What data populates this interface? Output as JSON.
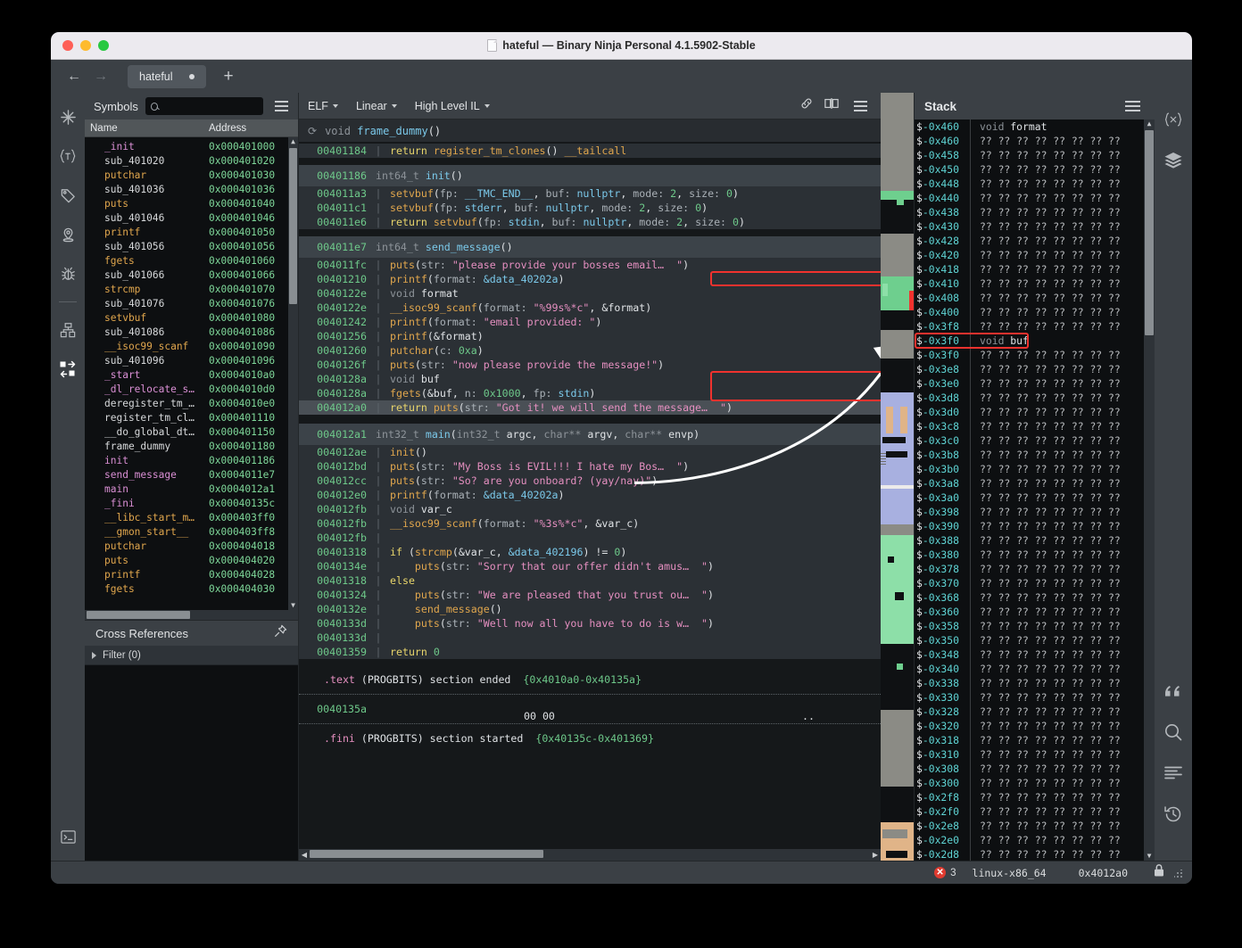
{
  "window": {
    "title": "hateful — Binary Ninja Personal 4.1.5902-Stable",
    "doc_icon": "document-icon"
  },
  "tabbar": {
    "back_icon": "←",
    "forward_icon": "→",
    "tab_label": "hateful",
    "new_tab_icon": "+"
  },
  "left_rail": {
    "icons": [
      "symbols-icon",
      "types-icon",
      "tags-icon",
      "locations-icon",
      "bug-icon",
      "memory-map-icon",
      "stack-transfer-icon",
      "terminal-icon"
    ]
  },
  "symbols_panel": {
    "title": "Symbols",
    "search_placeholder": "",
    "search_value": "",
    "menu_icon": "hamburger-icon",
    "columns": [
      "Name",
      "Address"
    ],
    "rows": [
      {
        "name": "_init",
        "addr": "0x000401000",
        "kind": "imp"
      },
      {
        "name": "sub_401020",
        "addr": "0x000401020",
        "kind": "data"
      },
      {
        "name": "putchar",
        "addr": "0x000401030",
        "kind": "func"
      },
      {
        "name": "sub_401036",
        "addr": "0x000401036",
        "kind": "data"
      },
      {
        "name": "puts",
        "addr": "0x000401040",
        "kind": "func"
      },
      {
        "name": "sub_401046",
        "addr": "0x000401046",
        "kind": "data"
      },
      {
        "name": "printf",
        "addr": "0x000401050",
        "kind": "func"
      },
      {
        "name": "sub_401056",
        "addr": "0x000401056",
        "kind": "data"
      },
      {
        "name": "fgets",
        "addr": "0x000401060",
        "kind": "func"
      },
      {
        "name": "sub_401066",
        "addr": "0x000401066",
        "kind": "data"
      },
      {
        "name": "strcmp",
        "addr": "0x000401070",
        "kind": "func"
      },
      {
        "name": "sub_401076",
        "addr": "0x000401076",
        "kind": "data"
      },
      {
        "name": "setvbuf",
        "addr": "0x000401080",
        "kind": "func"
      },
      {
        "name": "sub_401086",
        "addr": "0x000401086",
        "kind": "data"
      },
      {
        "name": "__isoc99_scanf",
        "addr": "0x000401090",
        "kind": "func"
      },
      {
        "name": "sub_401096",
        "addr": "0x000401096",
        "kind": "data"
      },
      {
        "name": "_start",
        "addr": "0x0004010a0",
        "kind": "imp"
      },
      {
        "name": "_dl_relocate_s…",
        "addr": "0x0004010d0",
        "kind": "imp"
      },
      {
        "name": "deregister_tm_…",
        "addr": "0x0004010e0",
        "kind": "data"
      },
      {
        "name": "register_tm_cl…",
        "addr": "0x000401110",
        "kind": "data"
      },
      {
        "name": "__do_global_dt…",
        "addr": "0x000401150",
        "kind": "data"
      },
      {
        "name": "frame_dummy",
        "addr": "0x000401180",
        "kind": "data"
      },
      {
        "name": "init",
        "addr": "0x000401186",
        "kind": "imp"
      },
      {
        "name": "send_message",
        "addr": "0x0004011e7",
        "kind": "imp"
      },
      {
        "name": "main",
        "addr": "0x0004012a1",
        "kind": "imp"
      },
      {
        "name": "_fini",
        "addr": "0x00040135c",
        "kind": "imp"
      },
      {
        "name": "__libc_start_m…",
        "addr": "0x000403ff0",
        "kind": "func"
      },
      {
        "name": "__gmon_start__",
        "addr": "0x000403ff8",
        "kind": "func"
      },
      {
        "name": "putchar",
        "addr": "0x000404018",
        "kind": "func"
      },
      {
        "name": "puts",
        "addr": "0x000404020",
        "kind": "func"
      },
      {
        "name": "printf",
        "addr": "0x000404028",
        "kind": "func"
      },
      {
        "name": "fgets",
        "addr": "0x000404030",
        "kind": "func"
      }
    ]
  },
  "cross_references": {
    "title": "Cross References",
    "pin_icon": "pin-icon",
    "filter_label": "Filter (0)"
  },
  "main_view": {
    "format_dropdown": "ELF",
    "layout_dropdown": "Linear",
    "il_dropdown": "High Level IL",
    "icons": [
      "link-icon",
      "split-pane-icon",
      "hamburger-icon"
    ],
    "current_function": "void frame_dummy()",
    "refresh_icon": "refresh-icon"
  },
  "code_lines": [
    {
      "type": "code",
      "addr": "00401184",
      "bar": true,
      "html": "<span class='k-kw'>return</span> <span class='k-call'>register_tm_clones</span><span class='k-white'>()</span> <span class='k-call'>__tailcall</span>"
    },
    {
      "type": "gap"
    },
    {
      "type": "header",
      "addr": "00401186",
      "html": "<span class='k-type'>int64_t</span> <span class='k-fn'>init</span><span class='k-white'>()</span>"
    },
    {
      "type": "code",
      "addr": "004011a3",
      "bar": true,
      "html": "<span class='k-call'>setvbuf</span><span class='k-white'>(</span><span class='k-arg'>fp: </span><span class='k-fn'>__TMC_END__</span><span class='k-white'>, </span><span class='k-arg'>buf: </span><span class='k-fn'>nullptr</span><span class='k-white'>, </span><span class='k-arg'>mode: </span><span class='k-num'>2</span><span class='k-white'>, </span><span class='k-arg'>size: </span><span class='k-num'>0</span><span class='k-white'>)</span>"
    },
    {
      "type": "code",
      "addr": "004011c1",
      "bar": true,
      "html": "<span class='k-call'>setvbuf</span><span class='k-white'>(</span><span class='k-arg'>fp: </span><span class='k-fn'>stderr</span><span class='k-white'>, </span><span class='k-arg'>buf: </span><span class='k-fn'>nullptr</span><span class='k-white'>, </span><span class='k-arg'>mode: </span><span class='k-num'>2</span><span class='k-white'>, </span><span class='k-arg'>size: </span><span class='k-num'>0</span><span class='k-white'>)</span>"
    },
    {
      "type": "code",
      "addr": "004011e6",
      "bar": true,
      "html": "<span class='k-kw'>return</span> <span class='k-call'>setvbuf</span><span class='k-white'>(</span><span class='k-arg'>fp: </span><span class='k-fn'>stdin</span><span class='k-white'>, </span><span class='k-arg'>buf: </span><span class='k-fn'>nullptr</span><span class='k-white'>, </span><span class='k-arg'>mode: </span><span class='k-num'>2</span><span class='k-white'>, </span><span class='k-arg'>size: </span><span class='k-num'>0</span><span class='k-white'>)</span>"
    },
    {
      "type": "gap"
    },
    {
      "type": "header",
      "addr": "004011e7",
      "html": "<span class='k-type'>int64_t</span> <span class='k-fn'>send_message</span><span class='k-white'>()</span>"
    },
    {
      "type": "code",
      "addr": "004011fc",
      "bar": true,
      "html": "<span class='k-call'>puts</span><span class='k-white'>(</span><span class='k-arg'>str: </span><span class='k-str'>\"please provide your bosses email…  \"</span><span class='k-white'>)</span>"
    },
    {
      "type": "code",
      "addr": "00401210",
      "bar": true,
      "html": "<span class='k-call'>printf</span><span class='k-white'>(</span><span class='k-arg'>format: </span><span class='k-fn'>&amp;data_40202a</span><span class='k-white'>)</span>"
    },
    {
      "type": "code",
      "addr": "0040122e",
      "bar": true,
      "html": "<span class='k-type'>void</span> <span class='k-var'>format</span>"
    },
    {
      "type": "code",
      "addr": "0040122e",
      "bar": true,
      "html": "<span class='k-call'>__isoc99_scanf</span><span class='k-white'>(</span><span class='k-arg'>format: </span><span class='k-str'>\"%99s%*c\"</span><span class='k-white'>, </span><span class='k-var'>&amp;format</span><span class='k-white'>)</span>"
    },
    {
      "type": "code",
      "addr": "00401242",
      "bar": true,
      "html": "<span class='k-call'>printf</span><span class='k-white'>(</span><span class='k-arg'>format: </span><span class='k-str'>\"email provided: \"</span><span class='k-white'>)</span>"
    },
    {
      "type": "code",
      "addr": "00401256",
      "bar": true,
      "html": "<span class='k-call'>printf</span><span class='k-white'>(</span><span class='k-var'>&amp;format</span><span class='k-white'>)</span>"
    },
    {
      "type": "code",
      "addr": "00401260",
      "bar": true,
      "html": "<span class='k-call'>putchar</span><span class='k-white'>(</span><span class='k-arg'>c: </span><span class='k-num'>0xa</span><span class='k-white'>)</span>"
    },
    {
      "type": "code",
      "addr": "0040126f",
      "bar": true,
      "html": "<span class='k-call'>puts</span><span class='k-white'>(</span><span class='k-arg'>str: </span><span class='k-str'>\"now please provide the message!\"</span><span class='k-white'>)</span>"
    },
    {
      "type": "code",
      "addr": "0040128a",
      "bar": true,
      "html": "<span class='k-type'>void</span> <span class='k-var'>buf</span>"
    },
    {
      "type": "code",
      "addr": "0040128a",
      "bar": true,
      "html": "<span class='k-call'>fgets</span><span class='k-white'>(</span><span class='k-var'>&amp;buf</span><span class='k-white'>, </span><span class='k-arg'>n: </span><span class='k-num'>0x1000</span><span class='k-white'>, </span><span class='k-arg'>fp: </span><span class='k-fn'>stdin</span><span class='k-white'>)</span>"
    },
    {
      "type": "code",
      "addr": "004012a0",
      "bar": true,
      "selected": true,
      "html": "<span class='k-kw'>return</span> <span class='k-call'>puts</span><span class='k-white'>(</span><span class='k-arg'>str: </span><span class='k-str'>\"Got it! we will send the message…  \"</span><span class='k-white'>)</span>"
    },
    {
      "type": "gap2"
    },
    {
      "type": "header",
      "addr": "004012a1",
      "html": "<span class='k-type'>int32_t</span> <span class='k-fn'>main</span><span class='k-white'>(</span><span class='k-type'>int32_t</span> <span class='k-var'>argc</span><span class='k-white'>, </span><span class='k-type'>char**</span> <span class='k-var'>argv</span><span class='k-white'>, </span><span class='k-type'>char**</span> <span class='k-var'>envp</span><span class='k-white'>)</span>"
    },
    {
      "type": "code",
      "addr": "004012ae",
      "bar": true,
      "html": "<span class='k-call'>init</span><span class='k-white'>()</span>"
    },
    {
      "type": "code",
      "addr": "004012bd",
      "bar": true,
      "html": "<span class='k-call'>puts</span><span class='k-white'>(</span><span class='k-arg'>str: </span><span class='k-str'>\"My Boss is EVIL!!! I hate my Bos…  \"</span><span class='k-white'>)</span>"
    },
    {
      "type": "code",
      "addr": "004012cc",
      "bar": true,
      "html": "<span class='k-call'>puts</span><span class='k-white'>(</span><span class='k-arg'>str: </span><span class='k-str'>\"So? are you onboard? (yay/nay)\"</span><span class='k-white'>)</span>"
    },
    {
      "type": "code",
      "addr": "004012e0",
      "bar": true,
      "html": "<span class='k-call'>printf</span><span class='k-white'>(</span><span class='k-arg'>format: </span><span class='k-fn'>&amp;data_40202a</span><span class='k-white'>)</span>"
    },
    {
      "type": "code",
      "addr": "004012fb",
      "bar": true,
      "html": "<span class='k-type'>void</span> <span class='k-var'>var_c</span>"
    },
    {
      "type": "code",
      "addr": "004012fb",
      "bar": true,
      "html": "<span class='k-call'>__isoc99_scanf</span><span class='k-white'>(</span><span class='k-arg'>format: </span><span class='k-str'>\"%3s%*c\"</span><span class='k-white'>, </span><span class='k-var'>&amp;var_c</span><span class='k-white'>)</span>"
    },
    {
      "type": "code",
      "addr": "004012fb",
      "bar": true,
      "html": ""
    },
    {
      "type": "code",
      "addr": "00401318",
      "bar": true,
      "html": "<span class='k-kw'>if</span> <span class='k-white'>(</span><span class='k-call'>strcmp</span><span class='k-white'>(</span><span class='k-var'>&amp;var_c</span><span class='k-white'>, </span><span class='k-fn'>&amp;data_402196</span><span class='k-white'>) != </span><span class='k-num'>0</span><span class='k-white'>)</span>"
    },
    {
      "type": "code",
      "addr": "0040134e",
      "bar": true,
      "indent": 1,
      "html": "<span class='k-call'>puts</span><span class='k-white'>(</span><span class='k-arg'>str: </span><span class='k-str'>\"Sorry that our offer didn't amus…  \"</span><span class='k-white'>)</span>"
    },
    {
      "type": "code",
      "addr": "00401318",
      "bar": true,
      "html": "<span class='k-kw'>else</span>"
    },
    {
      "type": "code",
      "addr": "00401324",
      "bar": true,
      "indent": 1,
      "html": "<span class='k-call'>puts</span><span class='k-white'>(</span><span class='k-arg'>str: </span><span class='k-str'>\"We are pleased that you trust ou…  \"</span><span class='k-white'>)</span>"
    },
    {
      "type": "code",
      "addr": "0040132e",
      "bar": true,
      "indent": 1,
      "html": "<span class='k-call'>send_message</span><span class='k-white'>()</span>"
    },
    {
      "type": "code",
      "addr": "0040133d",
      "bar": true,
      "indent": 1,
      "html": "<span class='k-call'>puts</span><span class='k-white'>(</span><span class='k-arg'>str: </span><span class='k-str'>\"Well now all you have to do is w…  \"</span><span class='k-white'>)</span>"
    },
    {
      "type": "code",
      "addr": "0040133d",
      "bar": true,
      "html": ""
    },
    {
      "type": "code",
      "addr": "00401359",
      "bar": true,
      "html": "<span class='k-kw'>return</span> <span class='k-num'>0</span>"
    },
    {
      "type": "gapdark"
    },
    {
      "type": "section",
      "html": "<span class='k-sec'>.text</span> <span class='k-white'>(PROGBITS) section ended</span>  <span class='k-addr'>{0x4010a0-0x40135a}</span>"
    },
    {
      "type": "dotted"
    },
    {
      "type": "bytes",
      "addr": "0040135a",
      "hex": "00 00",
      "ascii": ".."
    },
    {
      "type": "dotted"
    },
    {
      "type": "section",
      "html": "<span class='k-sec'>.fini</span> <span class='k-white'>(PROGBITS) section started</span>  <span class='k-addr'>{0x40135c-0x401369}</span>"
    }
  ],
  "highlights": {
    "printf_box": "printf(format: &data_40202a)",
    "fgets_box": "void buf / fgets(&buf, n: 0x1000, fp: stdin)",
    "stack_buf_box": "$-0x3f0 void buf",
    "color": "#f0322e"
  },
  "stack_panel": {
    "title": "Stack",
    "menu_icon": "hamburger-icon",
    "rows": [
      {
        "addr": "$-0x460",
        "value": "void format",
        "named": true,
        "type_word": "void"
      },
      {
        "addr": "$-0x460",
        "value": "?? ?? ?? ?? ?? ?? ?? ??"
      },
      {
        "addr": "$-0x458",
        "value": "?? ?? ?? ?? ?? ?? ?? ??"
      },
      {
        "addr": "$-0x450",
        "value": "?? ?? ?? ?? ?? ?? ?? ??"
      },
      {
        "addr": "$-0x448",
        "value": "?? ?? ?? ?? ?? ?? ?? ??"
      },
      {
        "addr": "$-0x440",
        "value": "?? ?? ?? ?? ?? ?? ?? ??"
      },
      {
        "addr": "$-0x438",
        "value": "?? ?? ?? ?? ?? ?? ?? ??"
      },
      {
        "addr": "$-0x430",
        "value": "?? ?? ?? ?? ?? ?? ?? ??"
      },
      {
        "addr": "$-0x428",
        "value": "?? ?? ?? ?? ?? ?? ?? ??"
      },
      {
        "addr": "$-0x420",
        "value": "?? ?? ?? ?? ?? ?? ?? ??"
      },
      {
        "addr": "$-0x418",
        "value": "?? ?? ?? ?? ?? ?? ?? ??"
      },
      {
        "addr": "$-0x410",
        "value": "?? ?? ?? ?? ?? ?? ?? ??"
      },
      {
        "addr": "$-0x408",
        "value": "?? ?? ?? ?? ?? ?? ?? ??"
      },
      {
        "addr": "$-0x400",
        "value": "?? ?? ?? ?? ?? ?? ?? ??"
      },
      {
        "addr": "$-0x3f8",
        "value": "?? ?? ?? ?? ?? ?? ?? ??"
      },
      {
        "addr": "$-0x3f0",
        "value": "void buf",
        "named": true,
        "highlight": true,
        "type_word": "void"
      },
      {
        "addr": "$-0x3f0",
        "value": "?? ?? ?? ?? ?? ?? ?? ??"
      },
      {
        "addr": "$-0x3e8",
        "value": "?? ?? ?? ?? ?? ?? ?? ??"
      },
      {
        "addr": "$-0x3e0",
        "value": "?? ?? ?? ?? ?? ?? ?? ??"
      },
      {
        "addr": "$-0x3d8",
        "value": "?? ?? ?? ?? ?? ?? ?? ??"
      },
      {
        "addr": "$-0x3d0",
        "value": "?? ?? ?? ?? ?? ?? ?? ??"
      },
      {
        "addr": "$-0x3c8",
        "value": "?? ?? ?? ?? ?? ?? ?? ??"
      },
      {
        "addr": "$-0x3c0",
        "value": "?? ?? ?? ?? ?? ?? ?? ??"
      },
      {
        "addr": "$-0x3b8",
        "value": "?? ?? ?? ?? ?? ?? ?? ??"
      },
      {
        "addr": "$-0x3b0",
        "value": "?? ?? ?? ?? ?? ?? ?? ??"
      },
      {
        "addr": "$-0x3a8",
        "value": "?? ?? ?? ?? ?? ?? ?? ??"
      },
      {
        "addr": "$-0x3a0",
        "value": "?? ?? ?? ?? ?? ?? ?? ??"
      },
      {
        "addr": "$-0x398",
        "value": "?? ?? ?? ?? ?? ?? ?? ??"
      },
      {
        "addr": "$-0x390",
        "value": "?? ?? ?? ?? ?? ?? ?? ??"
      },
      {
        "addr": "$-0x388",
        "value": "?? ?? ?? ?? ?? ?? ?? ??"
      },
      {
        "addr": "$-0x380",
        "value": "?? ?? ?? ?? ?? ?? ?? ??"
      },
      {
        "addr": "$-0x378",
        "value": "?? ?? ?? ?? ?? ?? ?? ??"
      },
      {
        "addr": "$-0x370",
        "value": "?? ?? ?? ?? ?? ?? ?? ??"
      },
      {
        "addr": "$-0x368",
        "value": "?? ?? ?? ?? ?? ?? ?? ??"
      },
      {
        "addr": "$-0x360",
        "value": "?? ?? ?? ?? ?? ?? ?? ??"
      },
      {
        "addr": "$-0x358",
        "value": "?? ?? ?? ?? ?? ?? ?? ??"
      },
      {
        "addr": "$-0x350",
        "value": "?? ?? ?? ?? ?? ?? ?? ??"
      },
      {
        "addr": "$-0x348",
        "value": "?? ?? ?? ?? ?? ?? ?? ??"
      },
      {
        "addr": "$-0x340",
        "value": "?? ?? ?? ?? ?? ?? ?? ??"
      },
      {
        "addr": "$-0x338",
        "value": "?? ?? ?? ?? ?? ?? ?? ??"
      },
      {
        "addr": "$-0x330",
        "value": "?? ?? ?? ?? ?? ?? ?? ??"
      },
      {
        "addr": "$-0x328",
        "value": "?? ?? ?? ?? ?? ?? ?? ??"
      },
      {
        "addr": "$-0x320",
        "value": "?? ?? ?? ?? ?? ?? ?? ??"
      },
      {
        "addr": "$-0x318",
        "value": "?? ?? ?? ?? ?? ?? ?? ??"
      },
      {
        "addr": "$-0x310",
        "value": "?? ?? ?? ?? ?? ?? ?? ??"
      },
      {
        "addr": "$-0x308",
        "value": "?? ?? ?? ?? ?? ?? ?? ??"
      },
      {
        "addr": "$-0x300",
        "value": "?? ?? ?? ?? ?? ?? ?? ??"
      },
      {
        "addr": "$-0x2f8",
        "value": "?? ?? ?? ?? ?? ?? ?? ??"
      },
      {
        "addr": "$-0x2f0",
        "value": "?? ?? ?? ?? ?? ?? ?? ??"
      },
      {
        "addr": "$-0x2e8",
        "value": "?? ?? ?? ?? ?? ?? ?? ??"
      },
      {
        "addr": "$-0x2e0",
        "value": "?? ?? ?? ?? ?? ?? ?? ??"
      },
      {
        "addr": "$-0x2d8",
        "value": "?? ?? ?? ?? ?? ?? ?? ??"
      }
    ]
  },
  "right_rail": {
    "icons": [
      "variables-icon",
      "layers-icon",
      "strings-icon",
      "search-icon",
      "log-icon",
      "history-icon"
    ]
  },
  "status_bar": {
    "error_count": "3",
    "error_icon": "error-icon",
    "platform": "linux-x86_64",
    "address": "0x4012a0",
    "lock_icon": "lock-icon"
  }
}
